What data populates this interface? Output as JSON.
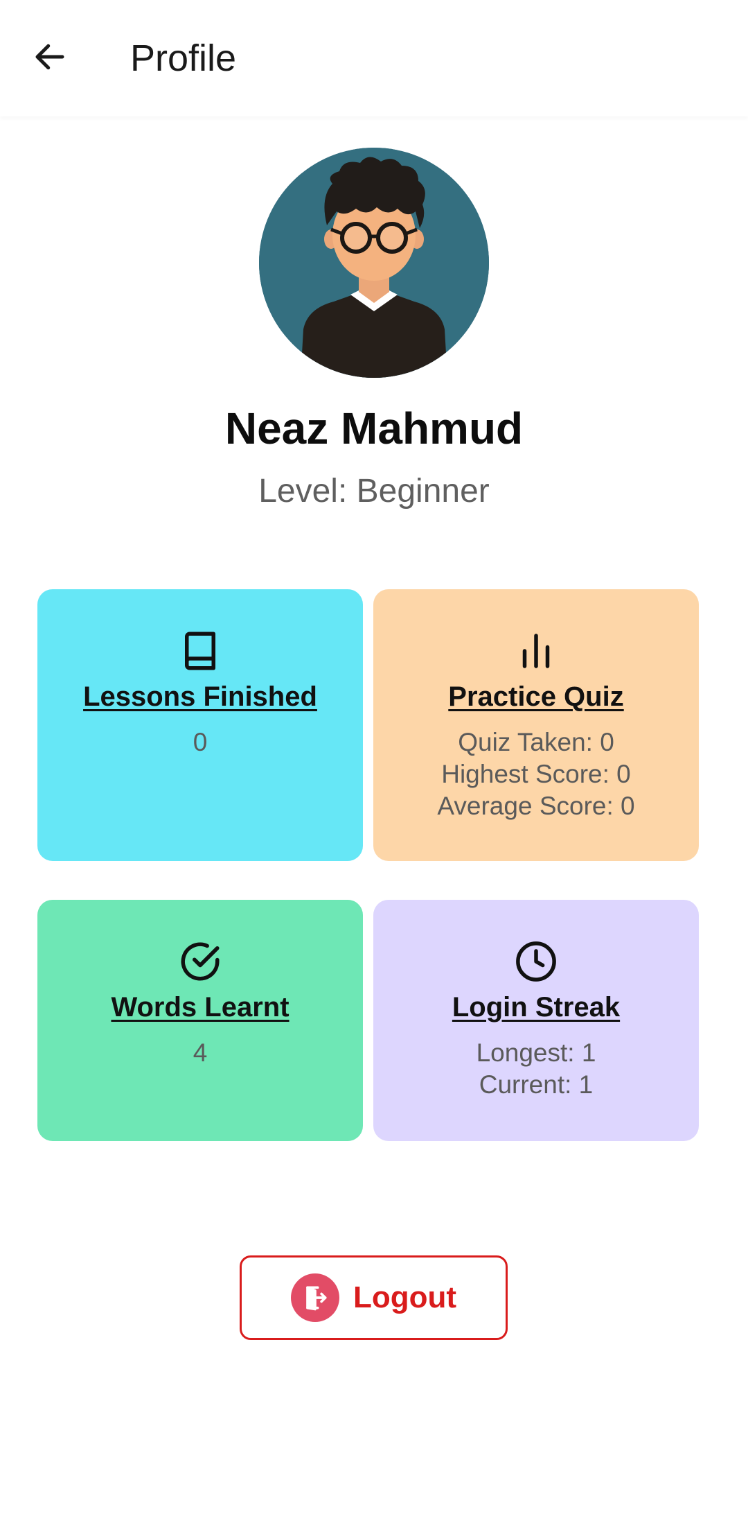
{
  "header": {
    "title": "Profile",
    "back_icon": "arrow-left-icon"
  },
  "profile": {
    "avatar_icon": "user-avatar-glasses",
    "name": "Neaz Mahmud",
    "level_label": "Level: ",
    "level_value": "Beginner"
  },
  "cards": {
    "lessons": {
      "icon": "book-icon",
      "title": "Lessons Finished",
      "value": "0",
      "color": "#66e7f6"
    },
    "quiz": {
      "icon": "bar-chart-icon",
      "title": "Practice Quiz",
      "stats": [
        "Quiz Taken: 0",
        "Highest Score: 0",
        "Average Score: 0"
      ],
      "color": "#fdd6a8"
    },
    "words": {
      "icon": "check-circle-icon",
      "title": "Words Learnt",
      "value": "4",
      "color": "#6ee7b5"
    },
    "streak": {
      "icon": "clock-icon",
      "title": "Login Streak",
      "stats": [
        "Longest: 1",
        "Current: 1"
      ],
      "color": "#ddd6fe"
    }
  },
  "logout": {
    "label": "Logout",
    "icon": "logout-door-icon",
    "color": "#d91c1c"
  }
}
